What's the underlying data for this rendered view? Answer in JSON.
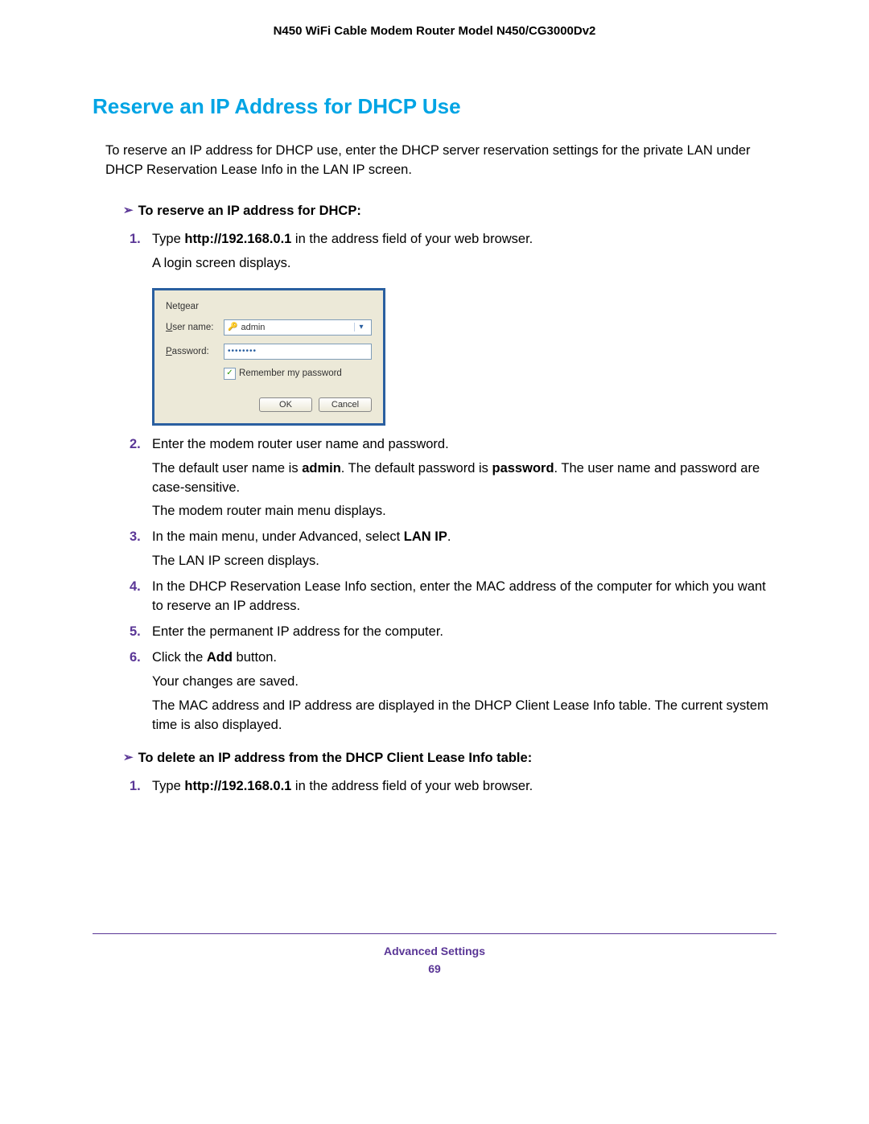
{
  "header": {
    "product_title": "N450 WiFi Cable Modem Router Model N450/CG3000Dv2"
  },
  "section": {
    "heading": "Reserve an IP Address for DHCP Use",
    "intro": "To reserve an IP address for DHCP use, enter the DHCP server reservation settings for the private LAN under DHCP Reservation Lease Info in the LAN IP screen."
  },
  "proc1": {
    "title": "To reserve an IP address for DHCP:",
    "steps": {
      "s1": {
        "pre": "Type ",
        "bold": "http://192.168.0.1",
        "post": " in the address field of your web browser.",
        "sub": "A login screen displays."
      },
      "s2": {
        "text": "Enter the modem router user name and password.",
        "sub1a": "The default user name is ",
        "sub1b": "admin",
        "sub1c": ". The default password is ",
        "sub1d": "password",
        "sub1e": ". The user name and password are case-sensitive.",
        "sub2": "The modem router main menu displays."
      },
      "s3": {
        "pre": "In the main menu, under Advanced, select ",
        "bold": "LAN IP",
        "post": ".",
        "sub": "The LAN IP screen displays."
      },
      "s4": {
        "text": "In the DHCP Reservation Lease Info section, enter the MAC address of the computer for which you want to reserve an IP address."
      },
      "s5": {
        "text": "Enter the permanent IP address for the computer."
      },
      "s6": {
        "pre": "Click the ",
        "bold": "Add",
        "post": " button.",
        "sub1": "Your changes are saved.",
        "sub2": "The MAC address and IP address are displayed in the DHCP Client Lease Info table. The current system time is also displayed."
      }
    }
  },
  "login_dialog": {
    "title": "Netgear",
    "username_label_u": "U",
    "username_label_rest": "ser name:",
    "username_value": "admin",
    "password_label_p": "P",
    "password_label_rest": "assword:",
    "password_mask": "••••••••",
    "remember_r": "R",
    "remember_rest": "emember my password",
    "ok": "OK",
    "cancel": "Cancel"
  },
  "proc2": {
    "title": "To delete an IP address from the DHCP Client Lease Info table:",
    "steps": {
      "s1": {
        "pre": "Type ",
        "bold": "http://192.168.0.1",
        "post": " in the address field of your web browser."
      }
    }
  },
  "footer": {
    "section": "Advanced Settings",
    "page": "69"
  }
}
